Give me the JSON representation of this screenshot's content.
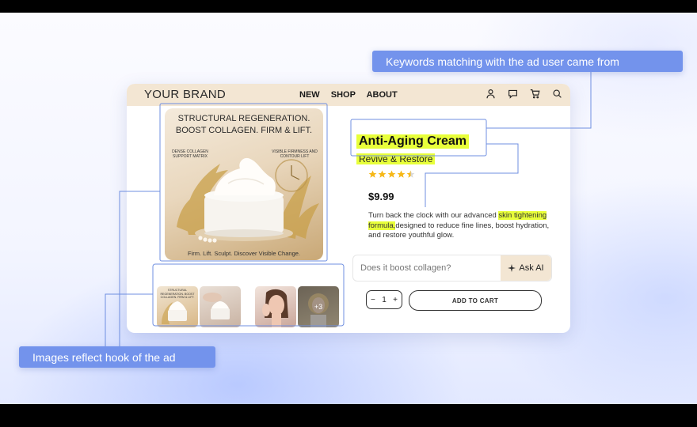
{
  "store": {
    "brand": "YOUR BRAND",
    "nav": [
      "NEW",
      "SHOP",
      "ABOUT"
    ],
    "icons": [
      "user-icon",
      "chat-icon",
      "cart-icon",
      "search-icon"
    ]
  },
  "gallery": {
    "main_title_line1": "STRUCTURAL REGENERATION.",
    "main_title_line2": "BOOST COLLAGEN. FIRM & LIFT.",
    "left_note": "DENSE COLLAGEN SUPPORT MATRIX",
    "right_note": "VISIBLE FIRMNESS AND CONTOUR LIFT",
    "footer": "Firm. Lift. Sculpt. Discover Visible Change.",
    "thumb1_text": "STRUCTURAL REGENERATION. BOOST COLLAGEN. FIRM & LIFT.",
    "more_label": "+3"
  },
  "product": {
    "title": "Anti-Aging Cream",
    "subtitle": "Revive & Restore",
    "rating": 4.5,
    "rating_max": 5,
    "price": "$9.99",
    "desc_before": "Turn back the clock with our advanced",
    "desc_highlight": "skin tightening formula,",
    "desc_after": "designed to reduce fine lines, boost hydration, and restore youthful glow."
  },
  "assistant": {
    "placeholder": "Does it boost collagen?",
    "button_label": "Ask AI"
  },
  "purchase": {
    "minus": "−",
    "quantity": "1",
    "plus": "+",
    "add_to_cart": "ADD TO CART"
  },
  "callouts": {
    "keywords": "Keywords matching with the ad user came from",
    "images": "Images reflect hook of the ad"
  },
  "colors": {
    "highlight": "#e8ff3a",
    "callout": "#7393ec",
    "topbar": "#f3e6d3",
    "connector": "#6f8fe0"
  }
}
